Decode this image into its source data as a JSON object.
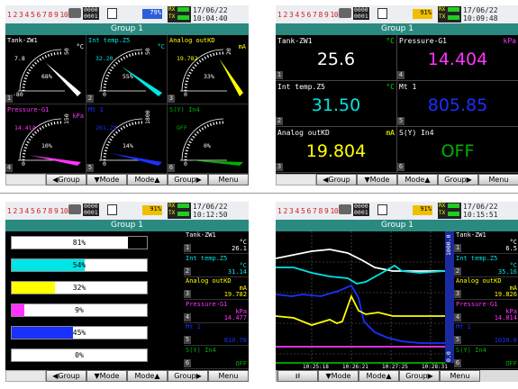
{
  "statusbars": [
    {
      "channels": [
        "1",
        "2",
        "3",
        "4",
        "5",
        "6",
        "7",
        "8",
        "9",
        "10"
      ],
      "counter": [
        "0000",
        "0001"
      ],
      "badge": "79%",
      "badge_bg": "#2b5fd9",
      "badge_fg": "#fff",
      "date": "17/06/22",
      "time": "10:04:40"
    },
    {
      "channels": [
        "1",
        "2",
        "3",
        "4",
        "5",
        "6",
        "7",
        "8",
        "9",
        "10"
      ],
      "counter": [
        "0000",
        "0001"
      ],
      "badge": "91%",
      "badge_bg": "#f0c000",
      "badge_fg": "#000",
      "date": "17/06/22",
      "time": "10:09:48"
    },
    {
      "channels": [
        "1",
        "2",
        "3",
        "4",
        "5",
        "6",
        "7",
        "8",
        "9",
        "10"
      ],
      "counter": [
        "0000",
        "0001"
      ],
      "badge": "91%",
      "badge_bg": "#f0c000",
      "badge_fg": "#000",
      "date": "17/06/22",
      "time": "10:12:50"
    },
    {
      "channels": [
        "1",
        "2",
        "3",
        "4",
        "5",
        "6",
        "7",
        "8",
        "9",
        "10"
      ],
      "counter": [
        "0000",
        "0001"
      ],
      "badge": "91%",
      "badge_bg": "#f0c000",
      "badge_fg": "#000",
      "date": "17/06/22",
      "time": "10:15:51"
    }
  ],
  "status_labels": {
    "rx": "RX",
    "tx": "TX"
  },
  "group_title": "Group 1",
  "menus": {
    "standard": [
      "◀Group",
      "▼Mode",
      "Mode▲",
      "Group▶",
      "Menu"
    ],
    "trend": [
      "⭳⭱",
      "▼Mode",
      "Mode▲",
      "Group▶",
      "Menu"
    ]
  },
  "meters": [
    {
      "no": "1",
      "name": "Tank-ZW1",
      "unit": "°C",
      "color": "#ffffff",
      "value": "7.8",
      "pct": "68%",
      "scale": [
        "-80",
        "50"
      ],
      "ptr": 0.68
    },
    {
      "no": "2",
      "name": "Int temp.Z5",
      "unit": "°C",
      "color": "#00e5e5",
      "value": "32.20",
      "pct": "55%",
      "scale": [
        "0",
        "50"
      ],
      "ptr": 0.55
    },
    {
      "no": "3",
      "name": "Analog outKD",
      "unit": "mA",
      "color": "#ffff00",
      "value": "19.782",
      "pct": "33%",
      "scale": [
        "0",
        "20"
      ],
      "ptr": 0.92
    },
    {
      "no": "4",
      "name": "Pressure-G1",
      "unit": "kPa",
      "color": "#ff33ff",
      "value": "14.414",
      "pct": "10%",
      "scale": [
        "0",
        "150"
      ],
      "ptr": 0.1
    },
    {
      "no": "5",
      "name": "Mt 1",
      "unit": "",
      "color": "#1a30ff",
      "value": "201.29",
      "pct": "14%",
      "scale": [
        "0",
        "1800"
      ],
      "ptr": 0.14
    },
    {
      "no": "6",
      "name": "S(Y) In4",
      "unit": "",
      "color": "#00b000",
      "value": "OFF",
      "pct": "0%",
      "scale": [
        "0",
        ""
      ],
      "ptr": 0.0
    }
  ],
  "digital": [
    {
      "no": "1",
      "name": "Tank-ZW1",
      "unit": "°C",
      "color": "#ffffff",
      "value": "25.6"
    },
    {
      "no": "2",
      "name": "Int temp.Z5",
      "unit": "°C",
      "color": "#00e5e5",
      "value": "31.50"
    },
    {
      "no": "3",
      "name": "Analog outKD",
      "unit": "mA",
      "color": "#ffff00",
      "value": "19.804"
    },
    {
      "no": "4",
      "name": "Pressure-G1",
      "unit": "kPa",
      "color": "#ff33ff",
      "value": "14.404"
    },
    {
      "no": "5",
      "name": "Mt 1",
      "unit": "",
      "color": "#1a30ff",
      "value": "805.85"
    },
    {
      "no": "6",
      "name": "S(Y) In4",
      "unit": "",
      "color": "#00b000",
      "value": "OFF"
    }
  ],
  "bars": [
    {
      "pct": "81%",
      "fill": 0.81,
      "color": "#ffffff"
    },
    {
      "pct": "54%",
      "fill": 0.54,
      "color": "#00e5e5"
    },
    {
      "pct": "32%",
      "fill": 0.32,
      "color": "#ffff00"
    },
    {
      "pct": "9%",
      "fill": 0.09,
      "color": "#ff33ff"
    },
    {
      "pct": "45%",
      "fill": 0.45,
      "color": "#1a30ff"
    },
    {
      "pct": "0%",
      "fill": 0.0,
      "color": "#00b000"
    }
  ],
  "bar_side": [
    {
      "no": "1",
      "name": "Tank-ZW1",
      "unit": "°C",
      "value": "26.1",
      "color": "#ffffff"
    },
    {
      "no": "2",
      "name": "Int temp.Z5",
      "unit": "°C",
      "value": "31.14",
      "color": "#00e5e5"
    },
    {
      "no": "3",
      "name": "Analog outKD",
      "unit": "mA",
      "value": "19.782",
      "color": "#ffff00"
    },
    {
      "no": "4",
      "name": "Pressure-G1",
      "unit": "kPa",
      "value": "14.477",
      "color": "#ff33ff"
    },
    {
      "no": "5",
      "name": "Mt 1",
      "unit": "",
      "value": "810.70",
      "color": "#1a30ff"
    },
    {
      "no": "6",
      "name": "S(Y) In4",
      "unit": "",
      "value": "OFF",
      "color": "#00b000"
    }
  ],
  "trend_side": [
    {
      "no": "1",
      "name": "Tank-ZW1",
      "unit": "°C",
      "value": "6.5",
      "color": "#ffffff"
    },
    {
      "no": "2",
      "name": "Int temp.Z5",
      "unit": "°C",
      "value": "35.16",
      "color": "#00e5e5"
    },
    {
      "no": "3",
      "name": "Analog outKD",
      "unit": "mA",
      "value": "19.826",
      "color": "#ffff00"
    },
    {
      "no": "4",
      "name": "Pressure-G1",
      "unit": "kPa",
      "value": "14.814",
      "color": "#ff33ff"
    },
    {
      "no": "5",
      "name": "Mt 1",
      "unit": "",
      "value": "1030.0",
      "color": "#1a30ff"
    },
    {
      "no": "6",
      "name": "S(Y) In4",
      "unit": "",
      "value": "OFF",
      "color": "#00b000"
    }
  ],
  "trend": {
    "times": [
      "10:25:18",
      "10:26:21",
      "10:27:25",
      "10:28:31"
    ],
    "scale_top": "1000.0",
    "scale_bottom": "0.0"
  }
}
